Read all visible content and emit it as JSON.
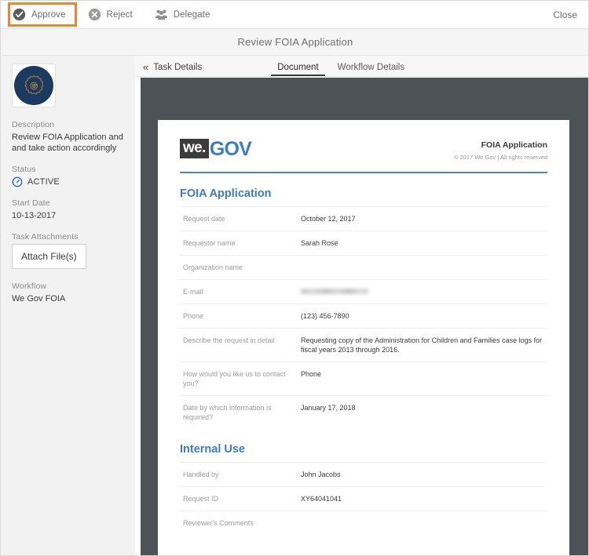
{
  "toolbar": {
    "actions": [
      {
        "label": "Approve",
        "icon": "check-circle-icon",
        "selected": true
      },
      {
        "label": "Reject",
        "icon": "x-circle-icon",
        "selected": false
      },
      {
        "label": "Delegate",
        "icon": "delegate-people-icon",
        "selected": false
      }
    ],
    "close_label": "Close"
  },
  "page_title": "Review FOIA Application",
  "sidebar": {
    "avatar_icon": "gov-seal-icon",
    "description_label": "Description",
    "description_value": "Review FOIA Application and and take action accordingly",
    "status_label": "Status",
    "status_value": "ACTIVE",
    "status_icon": "clock-circle-icon",
    "start_date_label": "Start Date",
    "start_date_value": "10-13-2017",
    "attachments_label": "Task Attachments",
    "attach_button": "Attach File(s)",
    "workflow_label": "Workflow",
    "workflow_value": "We Gov FOIA"
  },
  "tabbar": {
    "task_details_label": "Task Details",
    "collapse_icon": "double-chevron-left-icon",
    "tabs": [
      {
        "label": "Document",
        "active": true
      },
      {
        "label": "Workflow Details",
        "active": false
      }
    ]
  },
  "document": {
    "logo_mark": "we.",
    "logo_word": "GOV",
    "header_title": "FOIA Application",
    "header_copyright": "© 2017 We Gov | All rights reserved",
    "sections": [
      {
        "title": "FOIA Application",
        "rows": [
          {
            "key": "Request date",
            "value": "October 12, 2017",
            "redacted": false
          },
          {
            "key": "Requestor name",
            "value": "Sarah Rose",
            "redacted": false
          },
          {
            "key": "Organization name",
            "value": "",
            "redacted": false
          },
          {
            "key": "E-mail",
            "value": "",
            "redacted": true
          },
          {
            "key": "Phone",
            "value": "(123) 456-7890",
            "redacted": false
          },
          {
            "key": "Describe the request in detail",
            "value": "Requesting copy of the Administration for Children and Families case logs for fiscal years 2013 through 2016.",
            "redacted": false
          },
          {
            "key": "How would you like us to contact you?",
            "value": "Phone",
            "redacted": false
          },
          {
            "key": "Date by which information is required?",
            "value": "January 17, 2018",
            "redacted": false
          }
        ]
      },
      {
        "title": "Internal Use",
        "rows": [
          {
            "key": "Handled by",
            "value": "John Jacobs",
            "redacted": false
          },
          {
            "key": "Request ID",
            "value": "XY64041041",
            "redacted": false
          },
          {
            "key": "Reviewer's Comments",
            "value": "",
            "redacted": false
          }
        ]
      }
    ]
  },
  "colors": {
    "accent_orange": "#ef8332",
    "brand_blue": "#3d7cc9",
    "avatar_navy": "#1b3a5f",
    "viewer_gray": "#4d5256",
    "sidebar_gray": "#f2f2f2"
  }
}
